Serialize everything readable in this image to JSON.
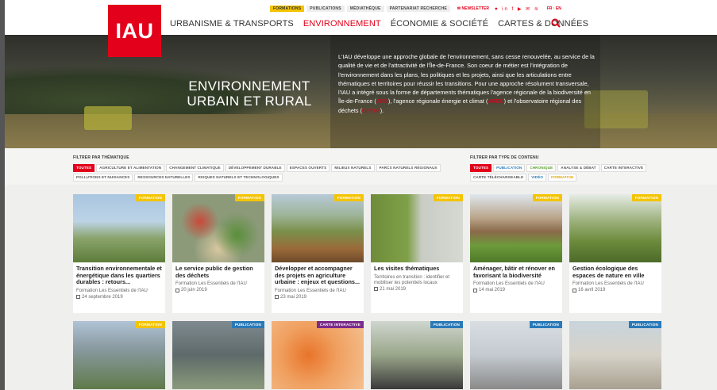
{
  "logo": "IAU",
  "toplinks": {
    "formations": "FORMATIONS",
    "publications": "PUBLICATIONS",
    "mediatheque": "MÉDIATHÈQUE",
    "partenariat": "PARTENARIAT RECHERCHE",
    "newsletter": "✉ NEWSLETTER",
    "social": "♥ in f ▶ ✉ ≋",
    "lang": "FR · EN"
  },
  "nav": {
    "urbanisme": "URBANISME & TRANSPORTS",
    "environnement": "ENVIRONNEMENT",
    "economie": "ÉCONOMIE & SOCIÉTÉ",
    "cartes": "CARTES & DONNÉES"
  },
  "hero": {
    "title_line1": "ENVIRONNEMENT",
    "title_line2": "URBAIN ET RURAL",
    "text_a": "L'IAU développe une approche globale de l'environnement, sans cesse renouvelée, au service de la qualité de vie et de l'attractivité de l'Île-de-France. Son coeur de métier est l'intégration de l'environnement dans les plans, les politiques et les projets, ainsi que les articulations entre thématiques et territoires pour réussir les transitions. Pour une approche résolument transversale, l'IAU a intégré sous la forme de départements thématiques l'agence régionale de la biodiversité en Île-de-France (",
    "arb": "ARB",
    "text_b": "), l'agence régionale énergie et climat (",
    "arec": "AREC",
    "text_c": ") et l'observatoire régional des déchets (",
    "ordif": "ORDIF",
    "text_d": ")."
  },
  "filters": {
    "thematique_label": "FILTRER PAR THÉMATIQUE",
    "thematique": [
      "TOUTES",
      "AGRICULTURE ET ALIMENTATION",
      "CHANGEMENT CLIMATIQUE",
      "DÉVELOPPEMENT DURABLE",
      "ESPACES OUVERTS",
      "MILIEUX NATURELS",
      "PARCS NATURELS RÉGIONAUX",
      "POLLUTIONS ET NUISANCES",
      "RESSOURCES NATURELLES",
      "RISQUES NATURELS ET TECHNOLOGIQUES"
    ],
    "type_label": "FILTRER PAR TYPE DE CONTENU",
    "type": [
      "TOUTES",
      "PUBLICATION",
      "CHRONIQUE",
      "ANALYSE & DÉBAT",
      "CARTE INTERACTIVE",
      "CARTE TÉLÉCHARGEABLE",
      "VIDÉO",
      "FORMATION"
    ]
  },
  "cards": [
    {
      "tag": "FORMATION",
      "title": "Transition environnementale et énergétique dans les quartiers durables : retours...",
      "meta": "Formation Les Essentiels de l'IAU",
      "date": "24 septembre 2019"
    },
    {
      "tag": "FORMATION",
      "title": "Le service public de gestion des déchets",
      "meta": "Formation Les Essentiels de l'IAU",
      "date": "20 juin 2019"
    },
    {
      "tag": "FORMATION",
      "title": "Développer et accompagner des projets en agriculture urbaine : enjeux et questions...",
      "meta": "Formation Les Essentiels de l'IAU",
      "date": "23 mai 2019"
    },
    {
      "tag": "FORMATION",
      "title": "Les visites thématiques",
      "meta": "Territoires en transition : identifier et mobiliser les potentiels locaux",
      "date": "21 mai 2019"
    },
    {
      "tag": "FORMATION",
      "title": "Aménager, bâtir et rénover en favorisant la biodiversité",
      "meta": "Formation Les Essentiels de l'IAU",
      "date": "14 mai 2019"
    },
    {
      "tag": "FORMATION",
      "title": "Gestion écologique des espaces de nature en ville",
      "meta": "Formation Les Essentiels de l'IAU",
      "date": "16 avril 2019"
    },
    {
      "tag": "FORMATION"
    },
    {
      "tag": "PUBLICATION"
    },
    {
      "tag": "CARTE INTERACTIVE"
    },
    {
      "tag": "PUBLICATION"
    },
    {
      "tag": "PUBLICATION"
    },
    {
      "tag": "PUBLICATION"
    }
  ],
  "colors": {
    "brand_red": "#e2001a",
    "formation": "#f4c400",
    "publication": "#2a7ab8",
    "carte": "#7b2c8a"
  }
}
